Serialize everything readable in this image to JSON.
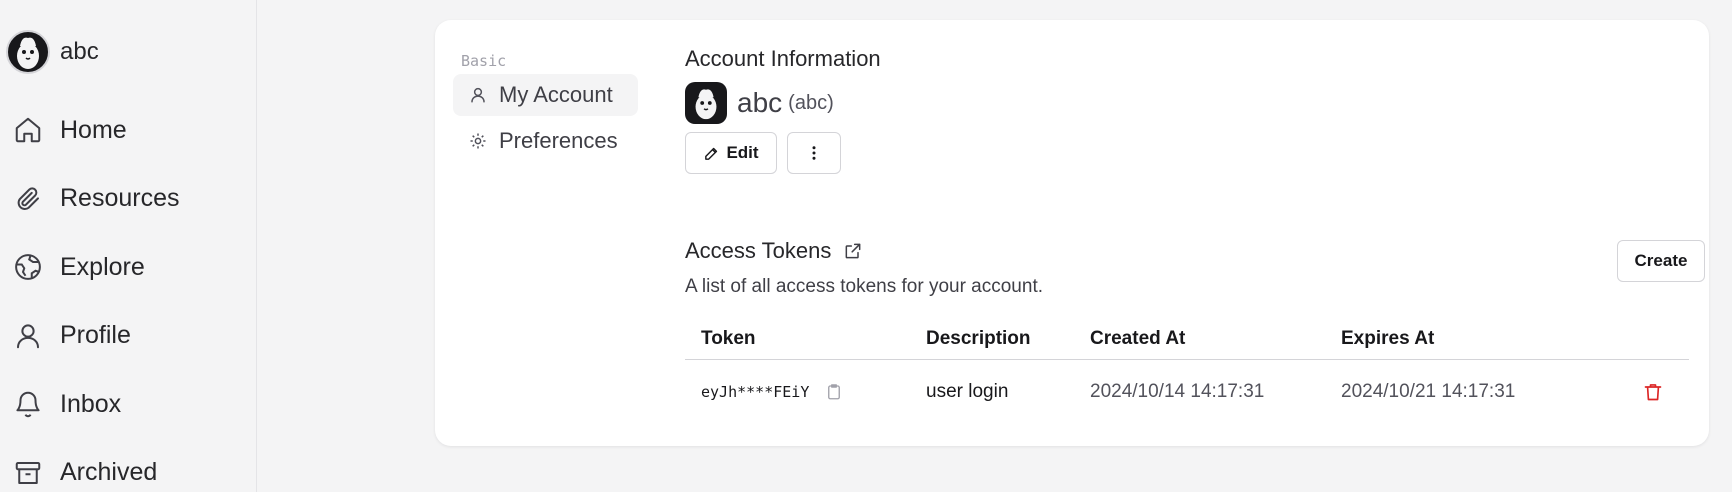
{
  "sidebar": {
    "user": {
      "name": "abc"
    },
    "items": [
      {
        "label": "Home",
        "icon": "home-icon"
      },
      {
        "label": "Resources",
        "icon": "paperclip-icon"
      },
      {
        "label": "Explore",
        "icon": "globe-icon"
      },
      {
        "label": "Profile",
        "icon": "user-icon"
      },
      {
        "label": "Inbox",
        "icon": "bell-icon"
      },
      {
        "label": "Archived",
        "icon": "archive-icon"
      }
    ]
  },
  "settings_menu": {
    "group_label": "Basic",
    "items": [
      {
        "label": "My Account",
        "icon": "user-icon",
        "active": true
      },
      {
        "label": "Preferences",
        "icon": "gear-icon",
        "active": false
      }
    ]
  },
  "account": {
    "section_title": "Account Information",
    "display_name": "abc",
    "username": "(abc)",
    "edit_label": "Edit"
  },
  "access_tokens": {
    "title": "Access Tokens",
    "description": "A list of all access tokens for your account.",
    "create_label": "Create",
    "columns": [
      "Token",
      "Description",
      "Created At",
      "Expires At"
    ],
    "rows": [
      {
        "token": "eyJh****FEiY",
        "description": "user login",
        "created_at": "2024/10/14 14:17:31",
        "expires_at": "2024/10/21 14:17:31"
      }
    ]
  },
  "colors": {
    "background": "#f4f4f5",
    "card": "#ffffff",
    "delete": "#dc2626",
    "text": "#27272a"
  }
}
